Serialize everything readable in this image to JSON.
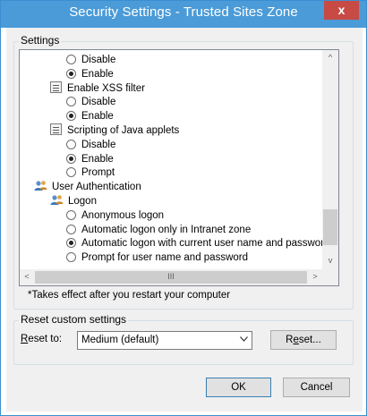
{
  "window": {
    "title": "Security Settings - Trusted Sites Zone",
    "close_label": "x"
  },
  "settings_group": {
    "label": "Settings",
    "tree_rows": [
      {
        "kind": "radio",
        "indent": 1,
        "label": "Disable",
        "checked": false
      },
      {
        "kind": "radio",
        "indent": 1,
        "label": "Enable",
        "checked": true
      },
      {
        "kind": "category",
        "indent": 0,
        "label": "Enable XSS filter",
        "icon": "settings-category-icon"
      },
      {
        "kind": "radio",
        "indent": 1,
        "label": "Disable",
        "checked": false
      },
      {
        "kind": "radio",
        "indent": 1,
        "label": "Enable",
        "checked": true
      },
      {
        "kind": "category",
        "indent": 0,
        "label": "Scripting of Java applets",
        "icon": "settings-category-icon"
      },
      {
        "kind": "radio",
        "indent": 1,
        "label": "Disable",
        "checked": false
      },
      {
        "kind": "radio",
        "indent": 1,
        "label": "Enable",
        "checked": true
      },
      {
        "kind": "radio",
        "indent": 1,
        "label": "Prompt",
        "checked": false
      },
      {
        "kind": "users",
        "indent": -1,
        "label": "User Authentication",
        "icon": "users-icon"
      },
      {
        "kind": "users",
        "indent": 0,
        "label": "Logon",
        "icon": "users-icon"
      },
      {
        "kind": "radio",
        "indent": 1,
        "label": "Anonymous logon",
        "checked": false
      },
      {
        "kind": "radio",
        "indent": 1,
        "label": "Automatic logon only in Intranet zone",
        "checked": false
      },
      {
        "kind": "radio",
        "indent": 1,
        "label": "Automatic logon with current user name and password",
        "checked": true
      },
      {
        "kind": "radio",
        "indent": 1,
        "label": "Prompt for user name and password",
        "checked": false
      }
    ],
    "scroll_up": "^",
    "scroll_down": "v",
    "scroll_left": "<",
    "scroll_right": ">",
    "hthumb_grip": "III",
    "note": "*Takes effect after you restart your computer"
  },
  "reset_group": {
    "label": "Reset custom settings",
    "reset_to_label_u": "R",
    "reset_to_label_rest": "eset to:",
    "selected_level": "Medium (default)",
    "reset_button_pre": "R",
    "reset_button_u": "e",
    "reset_button_post": "set..."
  },
  "footer": {
    "ok_label": "OK",
    "cancel_label": "Cancel"
  },
  "colors": {
    "titlebar": "#4a9bd8",
    "close": "#c74a45",
    "dialog_bg": "#f0f0f0"
  }
}
